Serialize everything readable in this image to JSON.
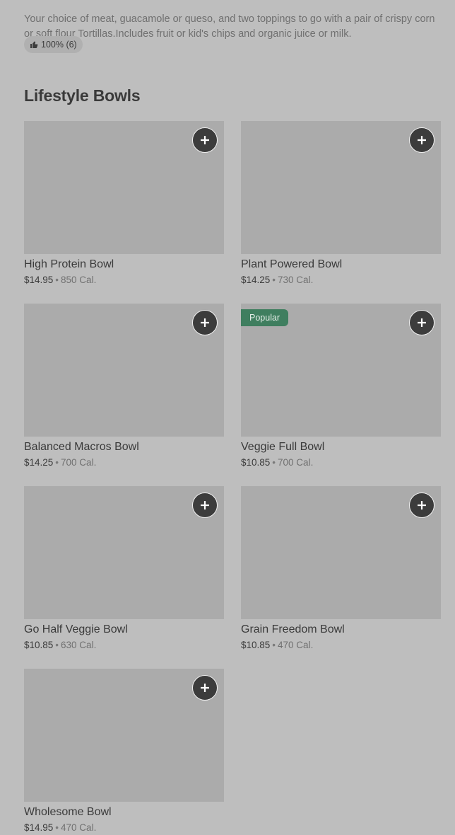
{
  "description": "Your choice of meat, guacamole or queso, and two toppings to go with a pair of crispy corn or soft flour Tortillas.Includes fruit or kid's chips and organic juice or milk.",
  "rating": {
    "icon": "thumbs-up-icon",
    "text": "100% (6)"
  },
  "section": {
    "title": "Lifestyle Bowls"
  },
  "items": [
    {
      "name": "High Protein Bowl",
      "price": "$14.95",
      "separator": "•",
      "calories": "850 Cal.",
      "badge": ""
    },
    {
      "name": "Plant Powered Bowl",
      "price": "$14.25",
      "separator": "•",
      "calories": "730 Cal.",
      "badge": ""
    },
    {
      "name": "Balanced Macros Bowl",
      "price": "$14.25",
      "separator": "•",
      "calories": "700 Cal.",
      "badge": ""
    },
    {
      "name": "Veggie Full Bowl",
      "price": "$10.85",
      "separator": "•",
      "calories": "700 Cal.",
      "badge": "Popular"
    },
    {
      "name": "Go Half Veggie Bowl",
      "price": "$10.85",
      "separator": "•",
      "calories": "630 Cal.",
      "badge": ""
    },
    {
      "name": "Grain Freedom Bowl",
      "price": "$10.85",
      "separator": "•",
      "calories": "470 Cal.",
      "badge": ""
    },
    {
      "name": "Wholesome Bowl",
      "price": "$14.95",
      "separator": "•",
      "calories": "470 Cal.",
      "badge": ""
    }
  ],
  "colors": {
    "background": "#bebebe",
    "thumbnail": "#ababab",
    "add_button": "#3c3c3c",
    "badge": "#3f7e5f"
  }
}
